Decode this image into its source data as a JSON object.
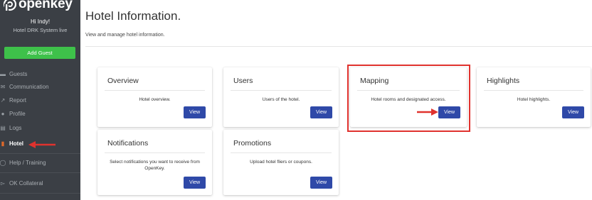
{
  "brand": {
    "name": "openkey"
  },
  "user": {
    "greeting": "Hi Indy!",
    "hotel": "Hotel DRK System live"
  },
  "sidebar": {
    "add_guest": "Add Guest",
    "items": [
      {
        "label": "Guests",
        "icon": "bed-icon"
      },
      {
        "label": "Communication",
        "icon": "envelope-icon"
      },
      {
        "label": "Report",
        "icon": "chart-icon"
      },
      {
        "label": "Profile",
        "icon": "user-icon"
      },
      {
        "label": "Logs",
        "icon": "list-icon"
      },
      {
        "label": "Hotel",
        "icon": "building-icon"
      },
      {
        "label": "Help / Training",
        "icon": "help-icon"
      },
      {
        "label": "OK Collateral",
        "icon": "cart-icon"
      }
    ]
  },
  "page": {
    "title": "Hotel Information.",
    "subtitle": "View and manage hotel information."
  },
  "cards": [
    {
      "title": "Overview",
      "desc": "Hotel overview.",
      "button": "View"
    },
    {
      "title": "Users",
      "desc": "Users of the hotel.",
      "button": "View"
    },
    {
      "title": "Mapping",
      "desc": "Hotel rooms and designated access.",
      "button": "View"
    },
    {
      "title": "Highlights",
      "desc": "Hotel highlights.",
      "button": "View"
    },
    {
      "title": "Notifications",
      "desc": "Select notifications you want to receive from OpenKey.",
      "button": "View"
    },
    {
      "title": "Promotions",
      "desc": "Upload hotel fliers or coupons.",
      "button": "View"
    }
  ],
  "colors": {
    "sidebar_bg": "#3b3f45",
    "accent_green": "#3ec14a",
    "button_blue": "#2f49a8",
    "annotation_red": "#e0322e",
    "active_icon": "#e06a2a"
  }
}
